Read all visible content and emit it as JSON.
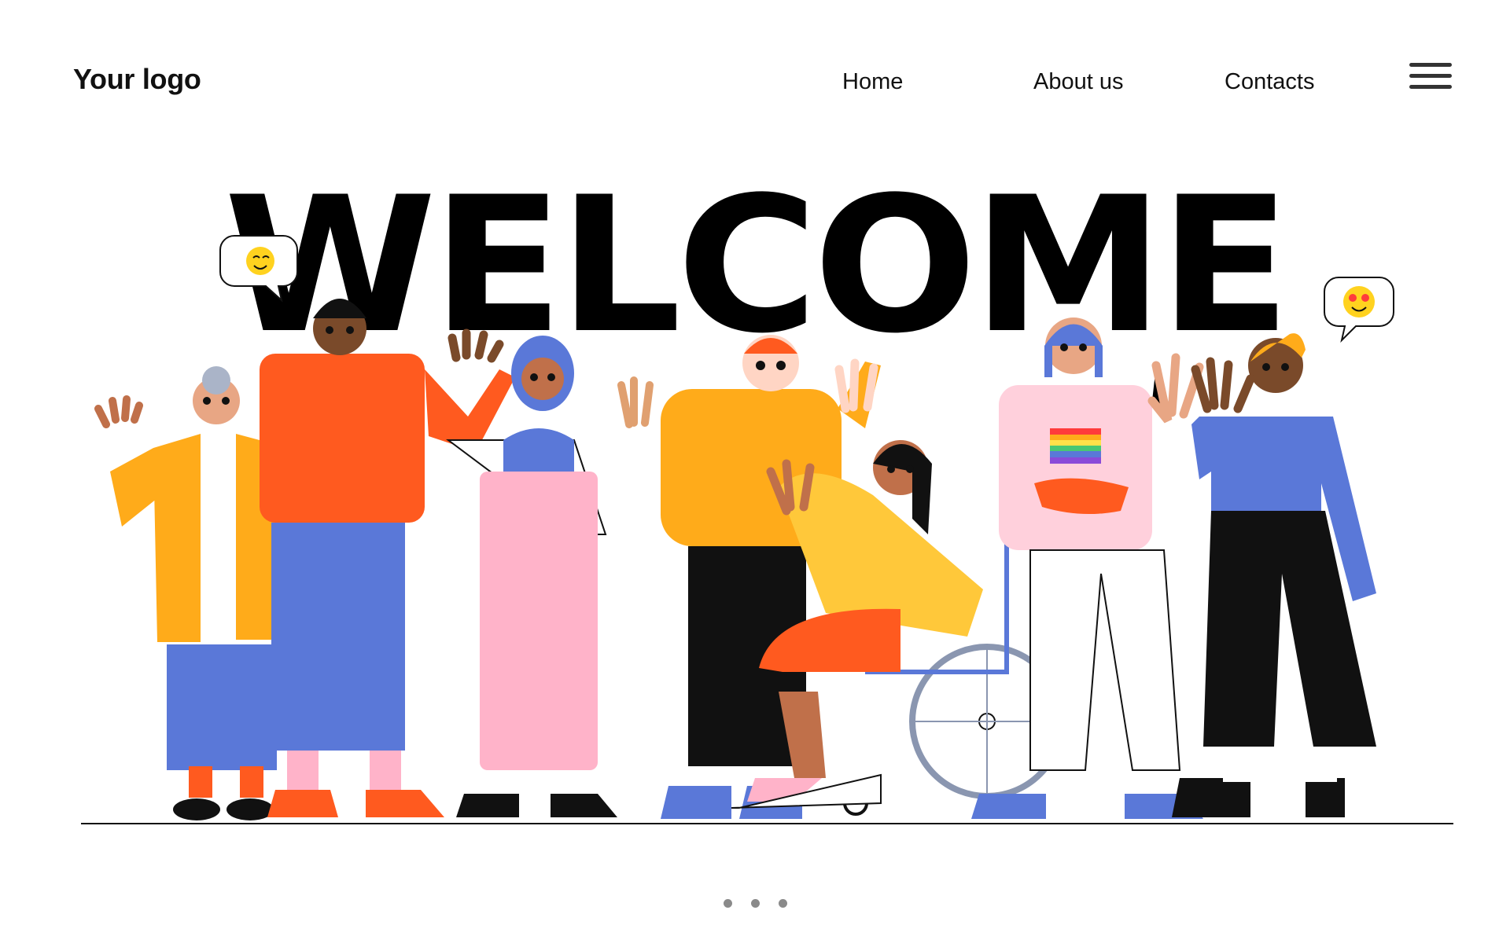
{
  "header": {
    "logo": "Your logo",
    "nav": [
      {
        "label": "Home"
      },
      {
        "label": "About us"
      },
      {
        "label": "Contacts"
      }
    ],
    "menu_icon": "hamburger-menu-icon"
  },
  "hero": {
    "title": "WELCOME"
  },
  "pagination": {
    "count": 3
  },
  "colors": {
    "background": "#ffffff",
    "text": "#000000",
    "orange": "#ff5a1f",
    "yellow": "#ffab1a",
    "blue": "#5a78d8",
    "pink": "#ffb3c9"
  }
}
